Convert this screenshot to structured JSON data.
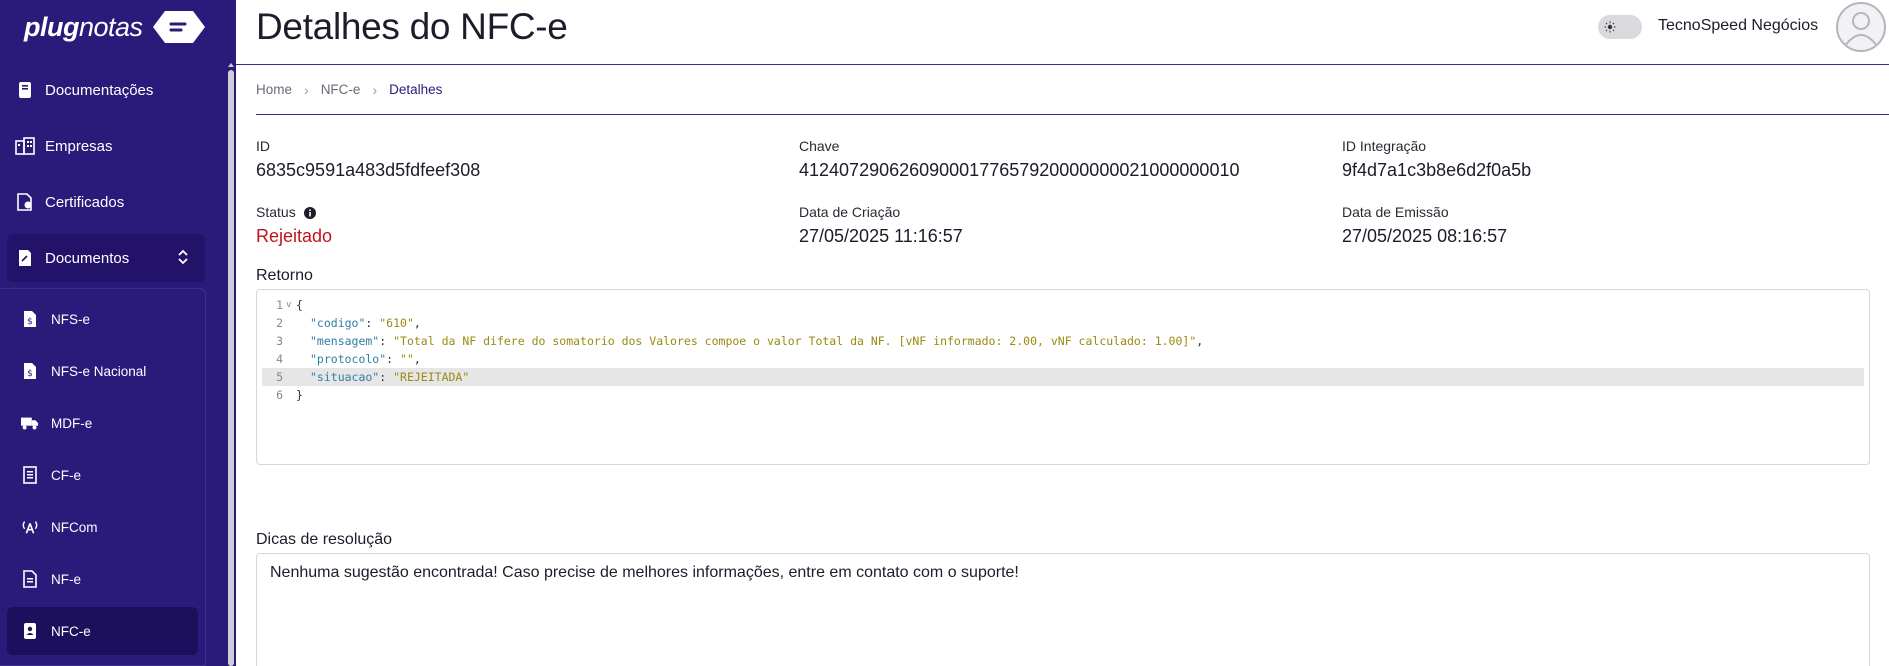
{
  "brand": {
    "name_bold": "plug",
    "name_light": "notas"
  },
  "sidebar": {
    "items": [
      {
        "label": "Documentações",
        "icon": "book-icon"
      },
      {
        "label": "Empresas",
        "icon": "buildings-icon"
      },
      {
        "label": "Certificados",
        "icon": "certificate-icon"
      },
      {
        "label": "Documentos",
        "icon": "documents-icon"
      }
    ],
    "subitems": [
      {
        "label": "NFS-e",
        "icon": "dollar-doc-icon"
      },
      {
        "label": "NFS-e Nacional",
        "icon": "dollar-doc-icon"
      },
      {
        "label": "MDF-e",
        "icon": "truck-icon"
      },
      {
        "label": "CF-e",
        "icon": "receipt-icon"
      },
      {
        "label": "NFCom",
        "icon": "antenna-icon"
      },
      {
        "label": "NF-e",
        "icon": "doc-icon"
      },
      {
        "label": "NFC-e",
        "icon": "contact-doc-icon",
        "active": true
      }
    ]
  },
  "header": {
    "title": "Detalhes do NFC-e",
    "company": "TecnoSpeed Negócios"
  },
  "breadcrumb": [
    "Home",
    "NFC-e",
    "Detalhes"
  ],
  "details": {
    "id_label": "ID",
    "id_value": "6835c9591a483d5fdfeef308",
    "chave_label": "Chave",
    "chave_value": "41240729062609000177657920000000021000000010",
    "integracao_label": "ID Integração",
    "integracao_value": "9f4d7a1c3b8e6d2f0a5b",
    "status_label": "Status",
    "status_value": "Rejeitado",
    "criacao_label": "Data de Criação",
    "criacao_value": "27/05/2025 11:16:57",
    "emissao_label": "Data de Emissão",
    "emissao_value": "27/05/2025 08:16:57"
  },
  "retorno": {
    "title": "Retorno",
    "lines": [
      {
        "n": "1",
        "open": "{"
      },
      {
        "n": "2",
        "key": "\"codigo\"",
        "val": "\"610\"",
        "comma": ","
      },
      {
        "n": "3",
        "key": "\"mensagem\"",
        "val": "\"Total da NF difere do somatorio dos Valores compoe o valor Total da NF. [vNF informado: 2.00, vNF calculado: 1.00]\"",
        "comma": ","
      },
      {
        "n": "4",
        "key": "\"protocolo\"",
        "val": "\"\"",
        "comma": ","
      },
      {
        "n": "5",
        "key": "\"situacao\"",
        "val": "\"REJEITADA\"",
        "comma": ""
      },
      {
        "n": "6",
        "open": "}"
      }
    ]
  },
  "dicas": {
    "title": "Dicas de resolução",
    "text": "Nenhuma sugestão encontrada! Caso precise de melhores informações, entre em contato com o suporte!"
  },
  "colors": {
    "sidebar": "#2a1a7a",
    "status_rejected": "#c0141e",
    "json_key": "#2f7fa8",
    "json_string": "#9a8a12"
  }
}
